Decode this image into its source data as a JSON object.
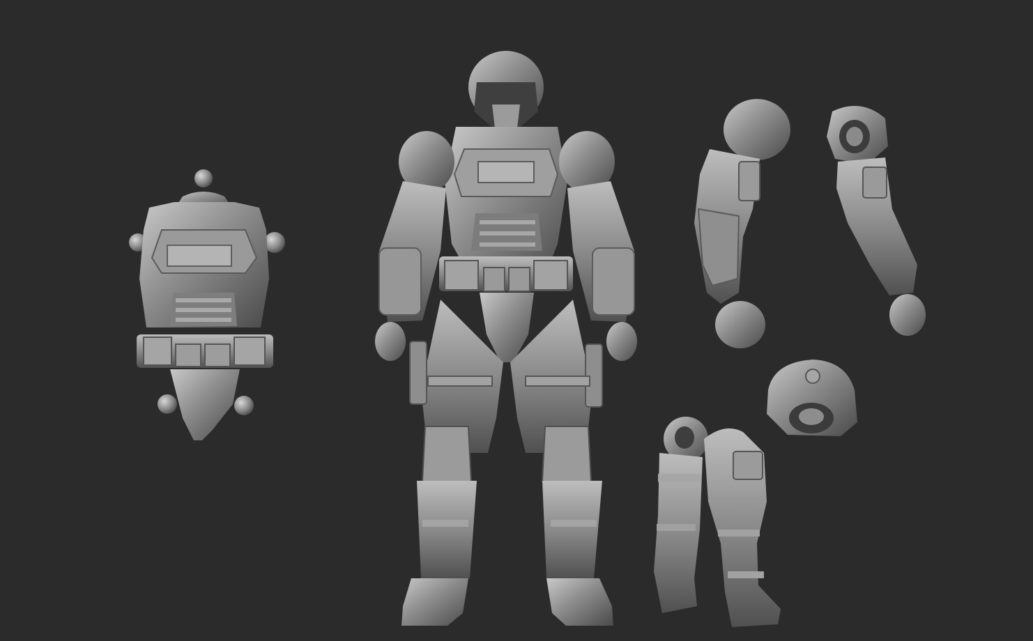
{
  "scene": {
    "background_color": "#2b2b2c",
    "material_color": "#8c8c8c",
    "material_highlight": "#c9c9c9",
    "material_shadow": "#4a4a4a",
    "subjects": [
      {
        "icon": "chest-armor-icon"
      },
      {
        "icon": "armored-soldier-figure-icon"
      },
      {
        "icon": "right-arm-icon"
      },
      {
        "icon": "left-arm-icon"
      },
      {
        "icon": "shoulder-joint-icon"
      },
      {
        "icon": "legs-icon"
      }
    ]
  }
}
